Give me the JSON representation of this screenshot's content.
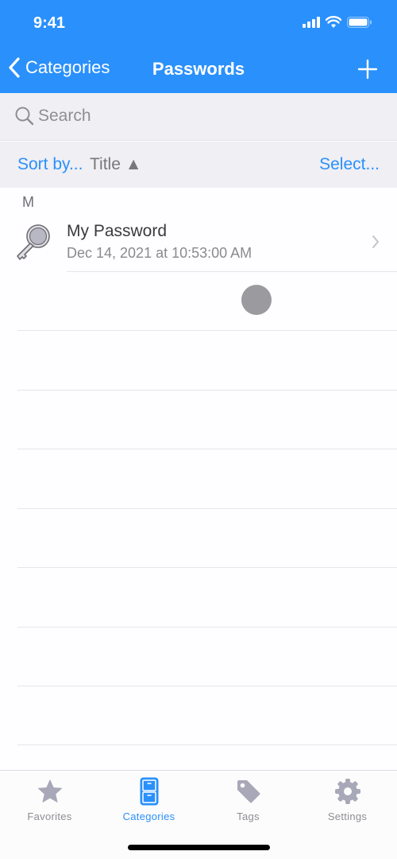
{
  "status_bar": {
    "time": "9:41"
  },
  "nav": {
    "back_label": "Categories",
    "title": "Passwords",
    "add_icon": "plus-icon"
  },
  "search": {
    "placeholder": "Search",
    "value": ""
  },
  "sort": {
    "label": "Sort by...",
    "value": "Title ▲",
    "select_label": "Select..."
  },
  "list": {
    "sections": [
      {
        "header": "M",
        "items": [
          {
            "title": "My Password",
            "subtitle": "Dec 14, 2021 at 10:53:00 AM",
            "icon": "key-icon"
          }
        ]
      }
    ]
  },
  "tabbar": {
    "tabs": [
      {
        "label": "Favorites",
        "icon": "star-icon",
        "active": false
      },
      {
        "label": "Categories",
        "icon": "cabinet-icon",
        "active": true
      },
      {
        "label": "Tags",
        "icon": "tag-icon",
        "active": false
      },
      {
        "label": "Settings",
        "icon": "gear-icon",
        "active": false
      }
    ]
  },
  "colors": {
    "accent": "#2a90fb",
    "inactive": "#8e8e93",
    "toolbar_bg": "#efeff4"
  }
}
